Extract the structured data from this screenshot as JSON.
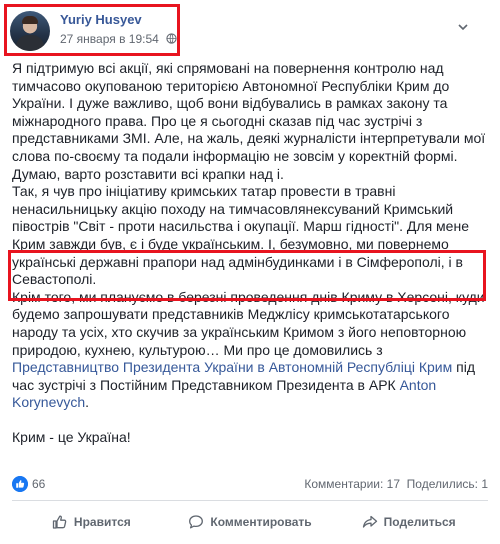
{
  "header": {
    "author": "Yuriy Husyev",
    "timestamp": "27 января в 19:54"
  },
  "body": {
    "p1": "Я підтримую всі акції, які спрямовані на повернення контролю над тимчасово окупованою територією Автономної Республіки Крим до України. І дуже важливо, щоб вони відбувались в рамках закону та міжнародного права. Про це я сьогодні сказав під час зустрічі з представниками ЗМІ. Але, на жаль, деякі журналісти інтерпретували мої слова по-своєму та подали інформацію не зовсім у коректній формі. Думаю, варто розставити всі крапки над і.",
    "p2": "Так, я чув про ініціативу кримських татар провести в травні ненасильницьку акцію походу на тимчасовлянексуваний Кримський півострів \"Світ - проти насильства і окупації. Марш гідності\". Для мене Крим завжди був, є і буде українським. І, безумовно, ми повернемо українські державні прапори над адмінбудинками і в Сімферополі, і в Севастополі.",
    "p3_before": "Крім того, ми плануємо в березні проведення днів Криму в Херсоні, куди будемо запрошувати представників Меджлісу кримськотатарського народу та усіх, хто скучив за українським Кримом з його неповторною природою, кухнею, культурою… Ми про це домовились з ",
    "p3_link1": "Представництво Президента України в Автономній Республіці Крим",
    "p3_middle": " під час зустрічі з Постійним Представником Президента в АРК ",
    "p3_link2": "Anton Korynevych",
    "p3_after": ".",
    "p4": "Крим - це Україна!"
  },
  "stats": {
    "likes": "66",
    "comments": "Комментарии: 17",
    "shares": "Поделились: 1"
  },
  "actions": {
    "like": "Нравится",
    "comment": "Комментировать",
    "share": "Поделиться"
  },
  "colors": {
    "link": "#385898",
    "highlight": "#e8141f",
    "like_badge": "#1877f2"
  }
}
